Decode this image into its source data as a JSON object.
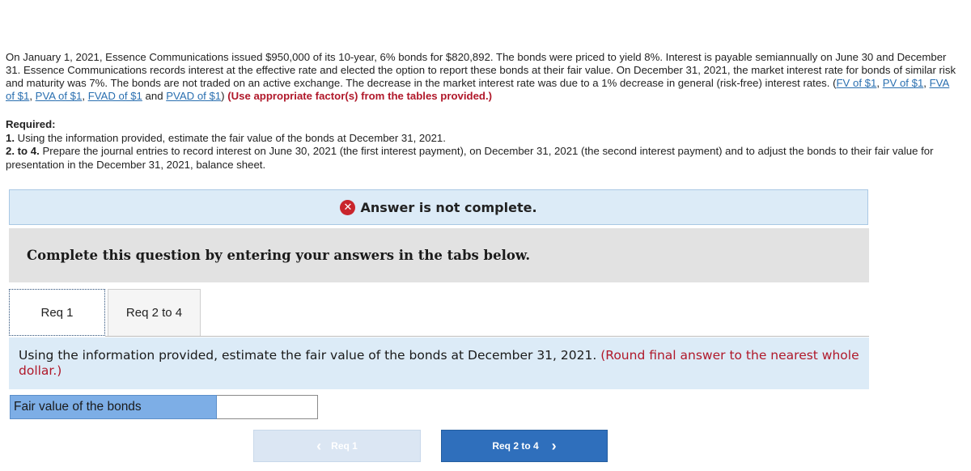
{
  "problem": {
    "text_main": "On January 1, 2021, Essence Communications issued $950,000 of its 10-year, 6% bonds for $820,892. The bonds were priced to yield 8%. Interest is payable semiannually on June 30 and December 31. Essence Communications records interest at the effective rate and elected the option to report these bonds at their fair value. On December 31, 2021, the market interest rate for bonds of similar risk and maturity was 7%. The bonds are not traded on an active exchange. The decrease in the market interest rate was due to a 1% decrease in general (risk-free) interest rates. (",
    "links": [
      "FV of $1",
      "PV of $1",
      "FVA of $1",
      "PVA of $1",
      "FVAD of $1",
      "PVAD of $1"
    ],
    "sep": ", ",
    "and_text": " and ",
    "close_paren": ")",
    "factor_note": " (Use appropriate factor(s) from the tables provided.)"
  },
  "required": {
    "heading": "Required:",
    "item1_num": "1.",
    "item1_text": " Using the information provided, estimate the fair value of the bonds at December 31, 2021.",
    "item2_num": "2. to 4.",
    "item2_text": " Prepare the journal entries to record interest on June 30, 2021 (the first interest payment), on December 31, 2021 (the second interest payment) and to adjust the bonds to their fair value for presentation in the December 31, 2021, balance sheet."
  },
  "banner": {
    "icon": "x-circle-icon",
    "text": "Answer is not complete."
  },
  "instruction": "Complete this question by entering your answers in the tabs below.",
  "tabs": [
    {
      "label": "Req 1",
      "active": true
    },
    {
      "label": "Req 2 to 4",
      "active": false
    }
  ],
  "question": {
    "text": "Using the information provided, estimate the fair value of the bonds at December 31, 2021. ",
    "note": "(Round final answer to the nearest whole dollar.)"
  },
  "answer": {
    "label": "Fair value of the bonds",
    "value": ""
  },
  "nav": {
    "prev_label": "Req 1",
    "next_label": "Req 2 to 4",
    "prev_icon": "chevron-left-icon",
    "next_icon": "chevron-right-icon"
  },
  "colors": {
    "accent_blue": "#2f6fbc",
    "error_red": "#c9252c",
    "note_red": "#b0182a",
    "banner_bg": "#dcebf7"
  }
}
